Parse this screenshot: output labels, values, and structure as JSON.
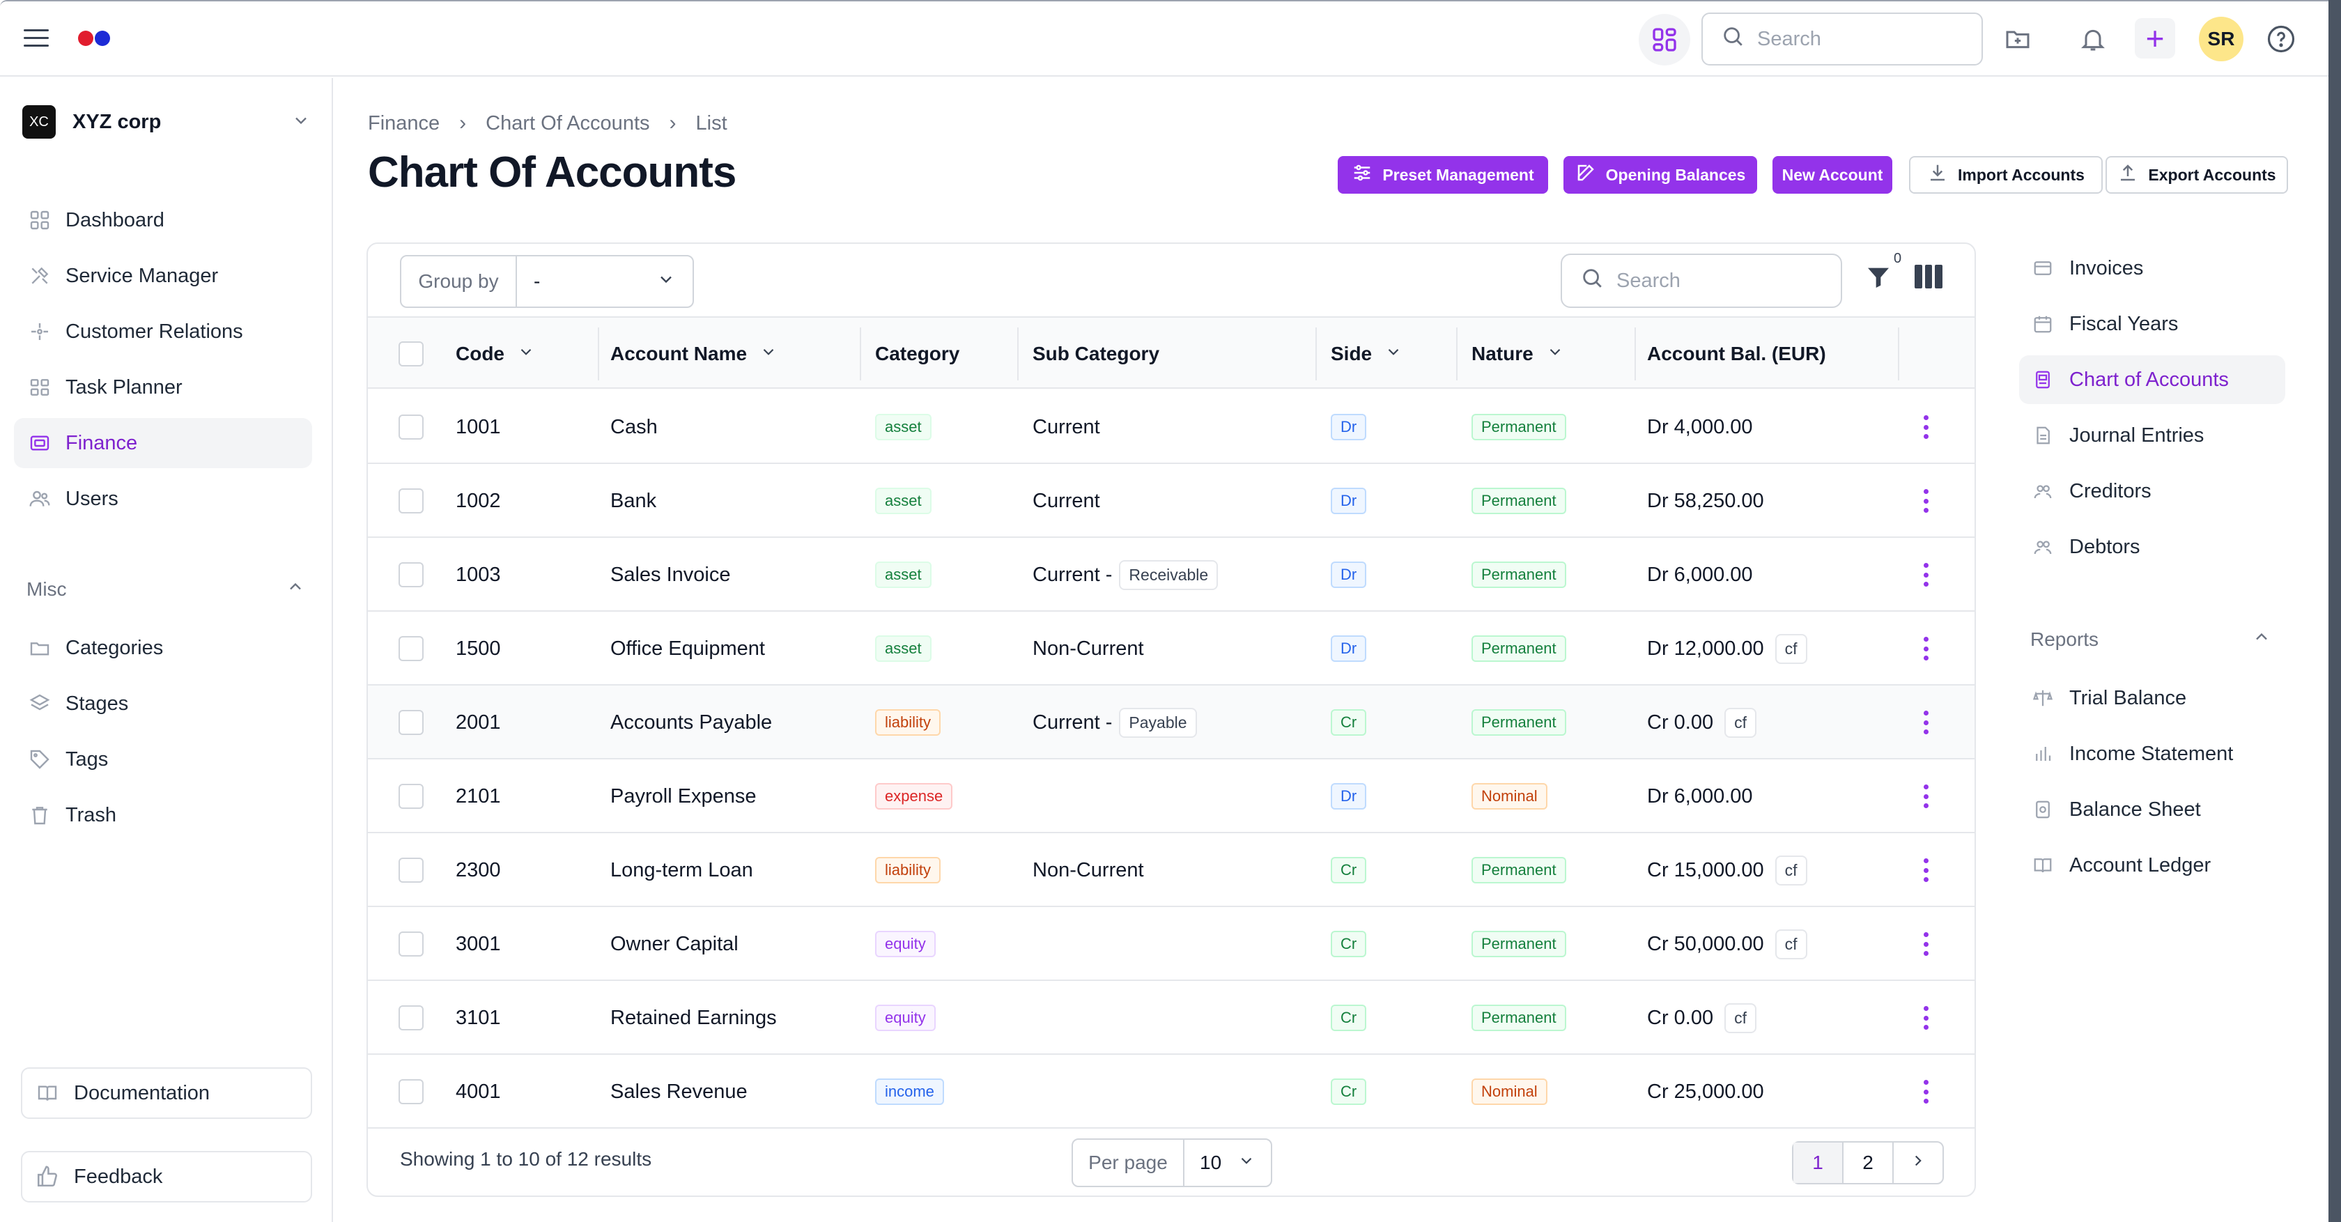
{
  "app": {
    "logo_colors": [
      "#e11d2e",
      "#1d2bd6"
    ],
    "accent": "#9333ea"
  },
  "topbar": {
    "search_placeholder": "Search",
    "avatar_initials": "SR",
    "icons": [
      "menu-icon",
      "apps-icon",
      "search-icon",
      "folder-add-icon",
      "bell-icon",
      "plus-icon",
      "help-icon"
    ]
  },
  "sidebar": {
    "org_badge": "XC",
    "org_name": "XYZ corp",
    "nav": [
      {
        "label": "Dashboard",
        "icon": "dashboard-icon"
      },
      {
        "label": "Service Manager",
        "icon": "tools-icon"
      },
      {
        "label": "Customer Relations",
        "icon": "sparkle-icon"
      },
      {
        "label": "Task Planner",
        "icon": "grid-icon"
      },
      {
        "label": "Finance",
        "icon": "finance-icon",
        "active": true
      },
      {
        "label": "Users",
        "icon": "users-icon"
      }
    ],
    "misc_title": "Misc",
    "misc": [
      {
        "label": "Categories",
        "icon": "folder-icon"
      },
      {
        "label": "Stages",
        "icon": "layers-icon"
      },
      {
        "label": "Tags",
        "icon": "tag-icon"
      },
      {
        "label": "Trash",
        "icon": "trash-icon"
      }
    ],
    "documentation": "Documentation",
    "feedback": "Feedback"
  },
  "breadcrumb": [
    "Finance",
    "Chart Of Accounts",
    "List"
  ],
  "page_title": "Chart Of Accounts",
  "actions": {
    "preset": "Preset Management",
    "opening": "Opening Balances",
    "new_account": "New Account",
    "import": "Import Accounts",
    "export": "Export Accounts"
  },
  "toolbar": {
    "group_by_label": "Group by",
    "group_by_value": "-",
    "search_placeholder": "Search",
    "filter_count": "0"
  },
  "table": {
    "headers": {
      "code": "Code",
      "name": "Account Name",
      "category": "Category",
      "sub_category": "Sub Category",
      "side": "Side",
      "nature": "Nature",
      "balance": "Account Bal. (EUR)"
    },
    "rows": [
      {
        "code": "1001",
        "name": "Cash",
        "category": "asset",
        "sub": "Current",
        "sub_chip": "",
        "side": "Dr",
        "nature": "Permanent",
        "balance": "Dr 4,000.00",
        "cf": ""
      },
      {
        "code": "1002",
        "name": "Bank",
        "category": "asset",
        "sub": "Current",
        "sub_chip": "",
        "side": "Dr",
        "nature": "Permanent",
        "balance": "Dr 58,250.00",
        "cf": ""
      },
      {
        "code": "1003",
        "name": "Sales Invoice",
        "category": "asset",
        "sub": "Current -",
        "sub_chip": "Receivable",
        "side": "Dr",
        "nature": "Permanent",
        "balance": "Dr 6,000.00",
        "cf": ""
      },
      {
        "code": "1500",
        "name": "Office Equipment",
        "category": "asset",
        "sub": "Non-Current",
        "sub_chip": "",
        "side": "Dr",
        "nature": "Permanent",
        "balance": "Dr 12,000.00",
        "cf": "cf"
      },
      {
        "code": "2001",
        "name": "Accounts Payable",
        "category": "liability",
        "sub": "Current -",
        "sub_chip": "Payable",
        "side": "Cr",
        "nature": "Permanent",
        "balance": "Cr 0.00",
        "cf": "cf"
      },
      {
        "code": "2101",
        "name": "Payroll Expense",
        "category": "expense",
        "sub": "",
        "sub_chip": "",
        "side": "Dr",
        "nature": "Nominal",
        "balance": "Dr 6,000.00",
        "cf": ""
      },
      {
        "code": "2300",
        "name": "Long-term Loan",
        "category": "liability",
        "sub": "Non-Current",
        "sub_chip": "",
        "side": "Cr",
        "nature": "Permanent",
        "balance": "Cr 15,000.00",
        "cf": "cf"
      },
      {
        "code": "3001",
        "name": "Owner Capital",
        "category": "equity",
        "sub": "",
        "sub_chip": "",
        "side": "Cr",
        "nature": "Permanent",
        "balance": "Cr 50,000.00",
        "cf": "cf"
      },
      {
        "code": "3101",
        "name": "Retained Earnings",
        "category": "equity",
        "sub": "",
        "sub_chip": "",
        "side": "Cr",
        "nature": "Permanent",
        "balance": "Cr 0.00",
        "cf": "cf"
      },
      {
        "code": "4001",
        "name": "Sales Revenue",
        "category": "income",
        "sub": "",
        "sub_chip": "",
        "side": "Cr",
        "nature": "Nominal",
        "balance": "Cr 25,000.00",
        "cf": ""
      }
    ]
  },
  "footer": {
    "showing": "Showing 1 to 10 of 12 results",
    "per_page_label": "Per page",
    "per_page_value": "10",
    "pages": [
      "1",
      "2"
    ]
  },
  "right_panel": {
    "items": [
      {
        "label": "Invoices",
        "icon": "invoice-icon"
      },
      {
        "label": "Fiscal Years",
        "icon": "calendar-icon"
      },
      {
        "label": "Chart of Accounts",
        "icon": "chart-accounts-icon",
        "active": true
      },
      {
        "label": "Journal Entries",
        "icon": "journal-icon"
      },
      {
        "label": "Creditors",
        "icon": "creditors-icon"
      },
      {
        "label": "Debtors",
        "icon": "debtors-icon"
      }
    ],
    "reports_title": "Reports",
    "reports": [
      {
        "label": "Trial Balance",
        "icon": "scale-icon"
      },
      {
        "label": "Income Statement",
        "icon": "bar-chart-icon"
      },
      {
        "label": "Balance Sheet",
        "icon": "sheet-icon"
      },
      {
        "label": "Account Ledger",
        "icon": "book-icon"
      }
    ]
  }
}
